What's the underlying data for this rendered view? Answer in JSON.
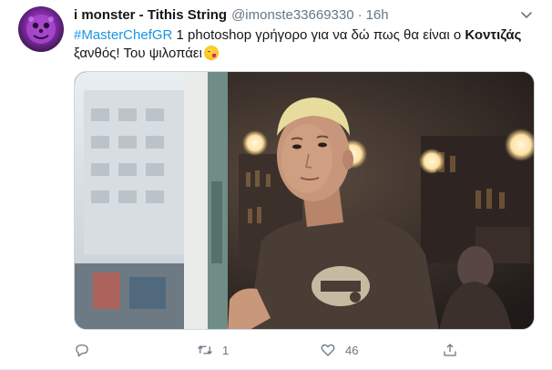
{
  "tweet": {
    "display_name": "i monster - Tithis String",
    "handle": "@imonste33669330",
    "separator": "·",
    "time": "16h",
    "text": {
      "hashtag": "#MasterChefGR",
      "part1": " 1 photoshop γρήγορο για να δώ πως θα είναι ο ",
      "bold_name": "Κοντιζάς",
      "part2": " ξανθός! Του ψιλοπάει",
      "emoji": "face-savoring-food-emoji"
    },
    "actions": {
      "reply": {
        "icon": "reply-icon",
        "count": ""
      },
      "retweet": {
        "icon": "retweet-icon",
        "count": "1"
      },
      "like": {
        "icon": "heart-icon",
        "count": "46"
      },
      "share": {
        "icon": "share-icon",
        "count": ""
      }
    }
  },
  "colors": {
    "text_primary": "#14171a",
    "text_secondary": "#657786",
    "link": "#1b95e0",
    "border": "#e6ecf0"
  }
}
